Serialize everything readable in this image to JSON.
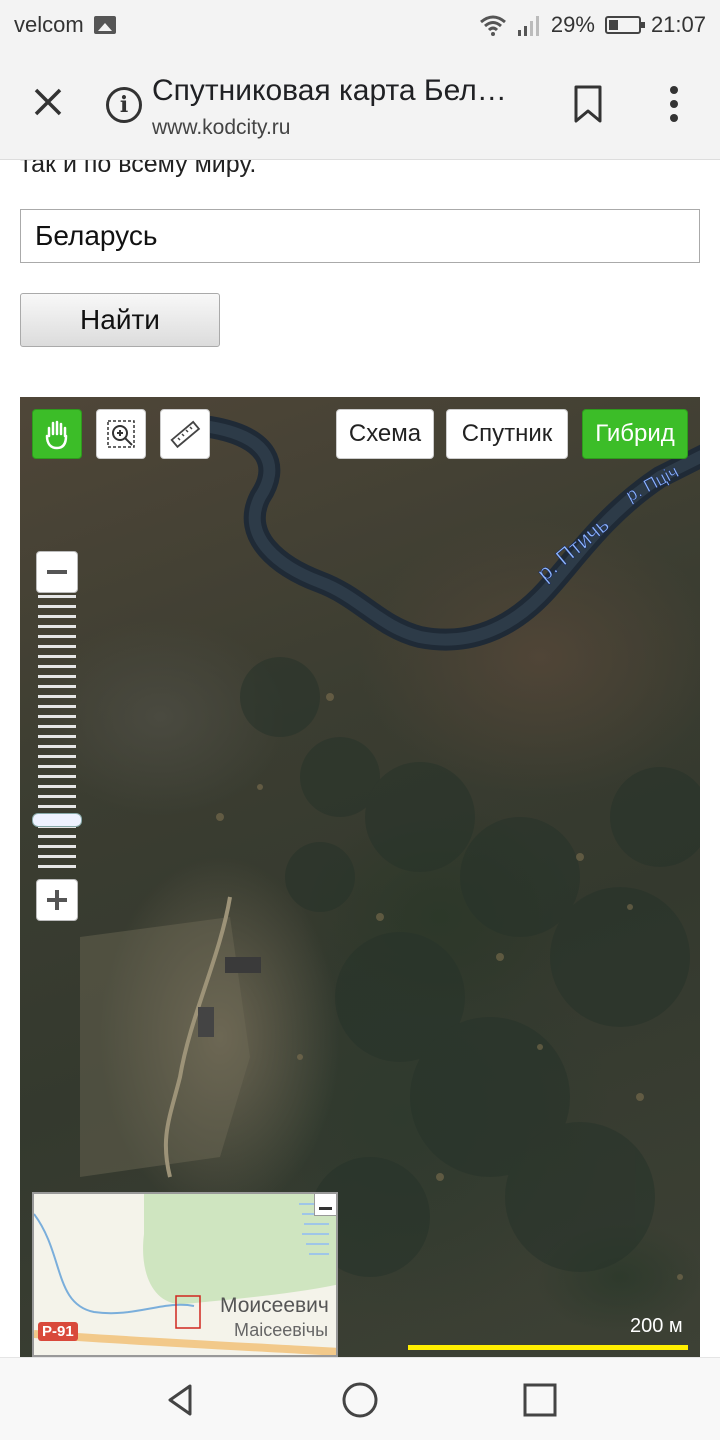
{
  "status_bar": {
    "carrier": "velcom",
    "battery": "29%",
    "time": "21:07"
  },
  "browser": {
    "title": "Спутниковая карта Бел…",
    "url": "www.kodcity.ru"
  },
  "page": {
    "cut_text": "так и по всему миру.",
    "search_value": "Беларусь",
    "search_button": "Найти"
  },
  "map": {
    "tools": {
      "pan": "hand-icon",
      "zoom_select": "zoom-rect-icon",
      "ruler": "ruler-icon"
    },
    "types": {
      "scheme": "Схема",
      "satellite": "Спутник",
      "hybrid": "Гибрид",
      "active": "hybrid"
    },
    "zoom_level": 0.82,
    "river_label": "р. Птичь",
    "river_label_alt": "р. Пціч",
    "minimap": {
      "town_ru": "Моисеевич",
      "town_be": "Маісеевічы",
      "road": "Р-91"
    },
    "scale_label": "200 м",
    "colors": {
      "active_button": "#3cbd28",
      "scale_bar": "#ffee00"
    }
  }
}
